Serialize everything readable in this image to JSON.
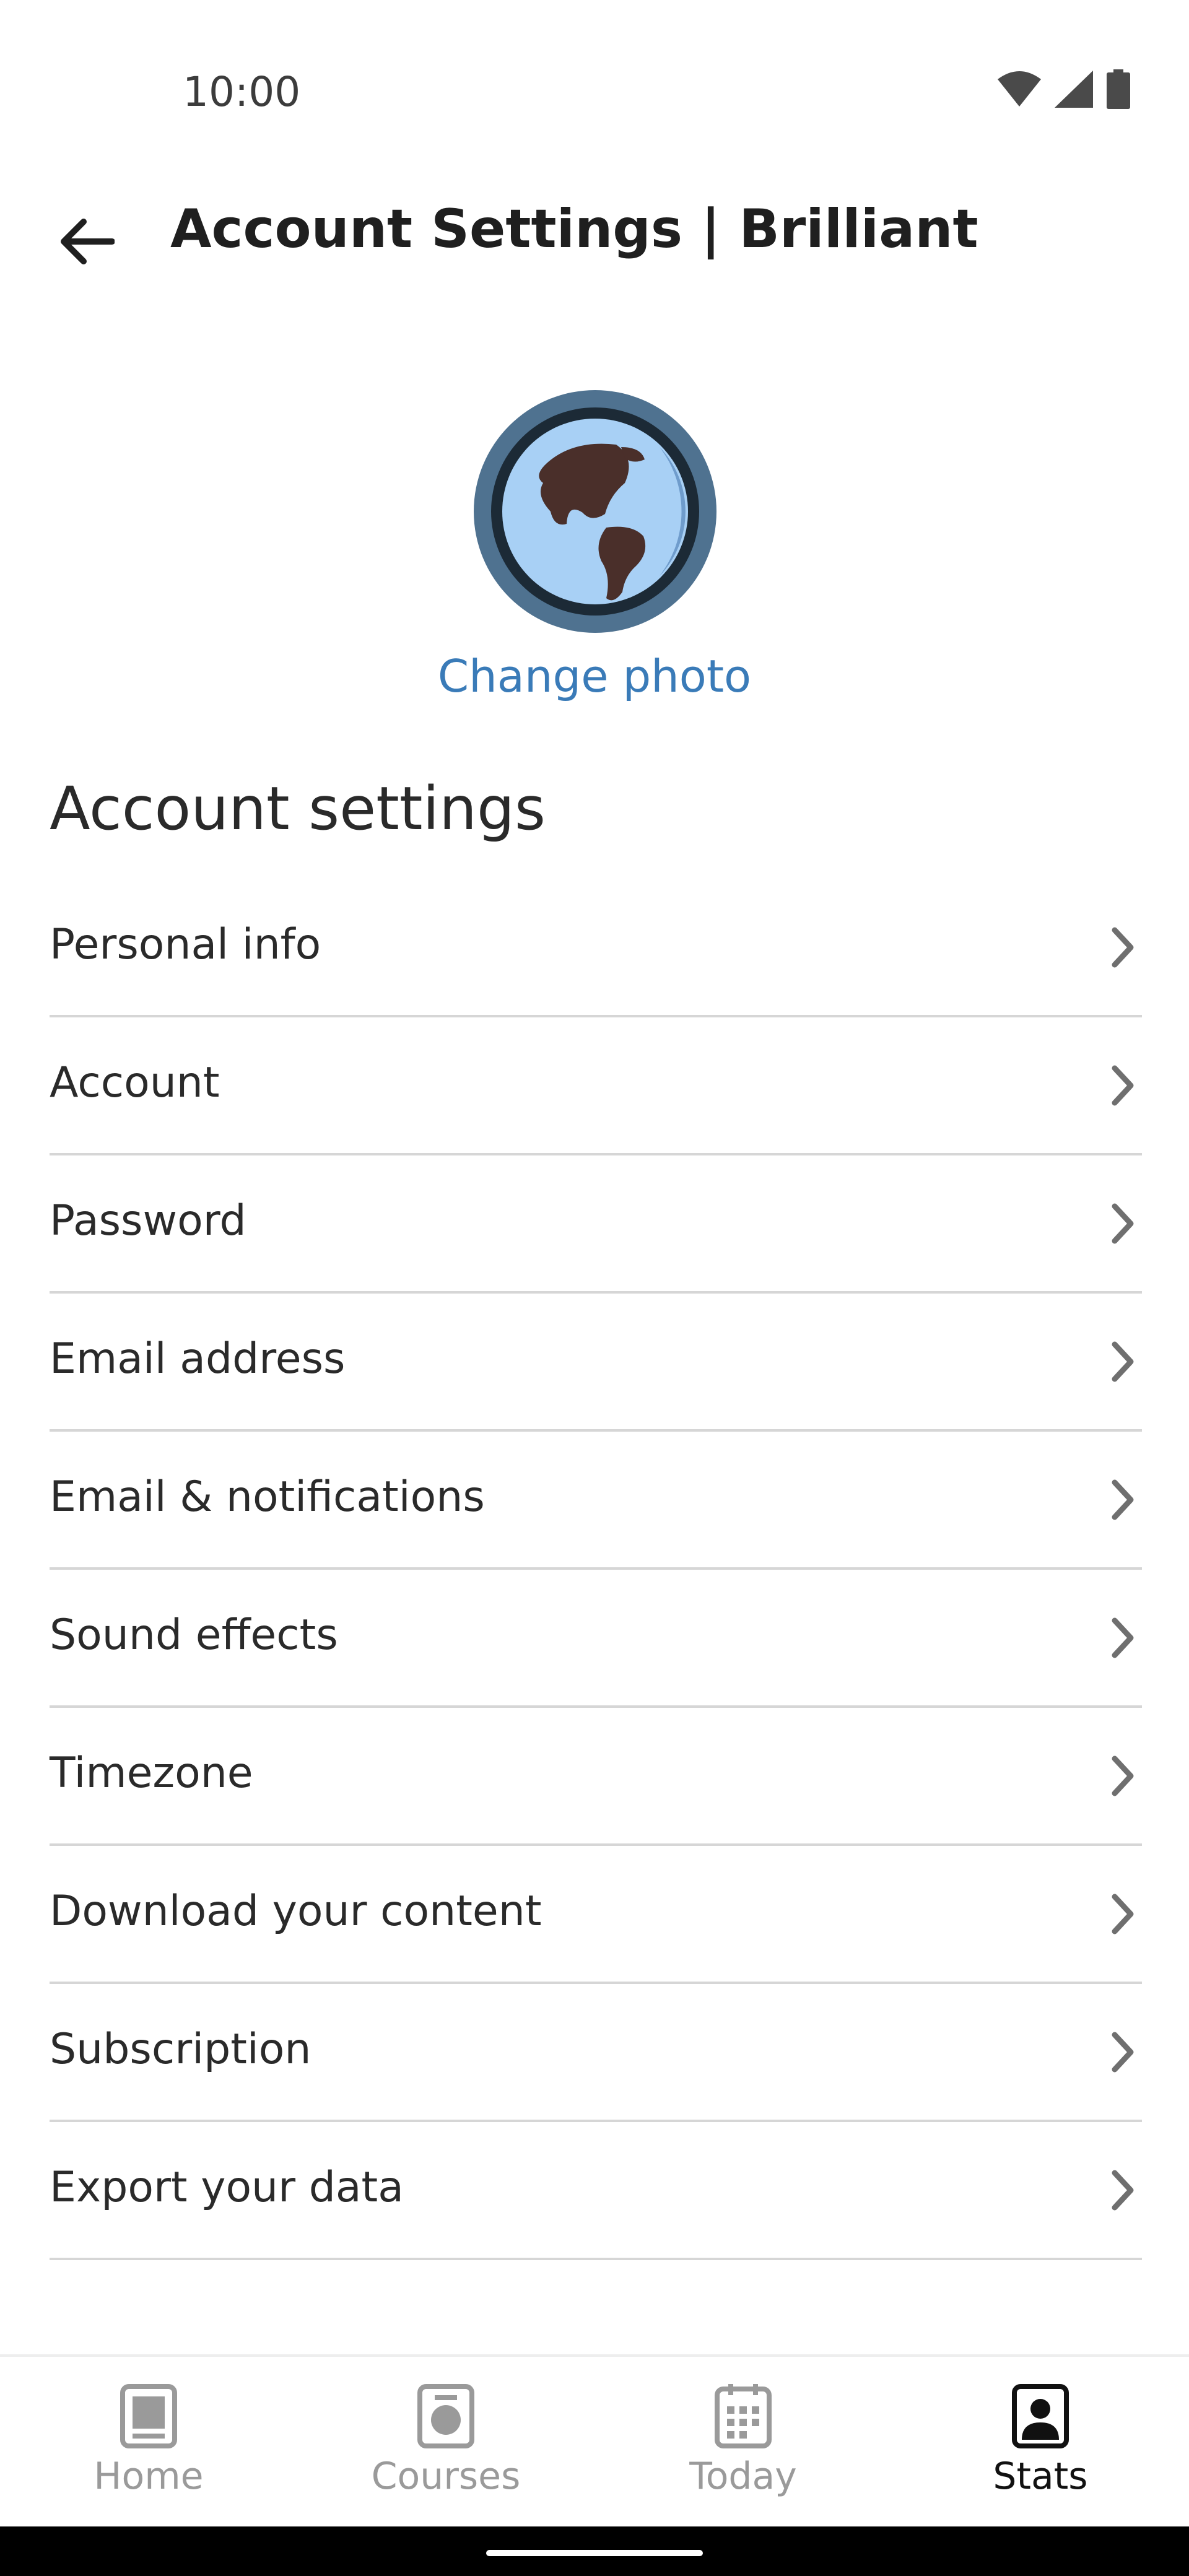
{
  "status_bar": {
    "time": "10:00",
    "icons": [
      "wifi-icon",
      "cell-signal-icon",
      "battery-icon"
    ]
  },
  "header": {
    "title": "Account Settings | Brilliant",
    "back_icon": "arrow-left-icon"
  },
  "profile": {
    "avatar_icon": "globe-icon",
    "change_photo_label": "Change photo"
  },
  "settings": {
    "heading": "Account settings",
    "items": [
      {
        "label": "Personal info"
      },
      {
        "label": "Account"
      },
      {
        "label": "Password"
      },
      {
        "label": "Email address"
      },
      {
        "label": "Email & notifications"
      },
      {
        "label": "Sound effects"
      },
      {
        "label": "Timezone"
      },
      {
        "label": "Download your content"
      },
      {
        "label": "Subscription"
      },
      {
        "label": "Export your data"
      }
    ]
  },
  "bottom_nav": {
    "items": [
      {
        "label": "Home",
        "icon": "home-icon",
        "active": false
      },
      {
        "label": "Courses",
        "icon": "courses-icon",
        "active": false
      },
      {
        "label": "Today",
        "icon": "calendar-icon",
        "active": false
      },
      {
        "label": "Stats",
        "icon": "stats-icon",
        "active": true
      }
    ]
  },
  "colors": {
    "accent": "#3a7bb8",
    "avatar_ring": "#4f7290",
    "globe_ocean": "#a8d0f5",
    "globe_land": "#4a2f2a",
    "inactive_nav": "#9a9a9a",
    "divider": "#d6d6d6"
  }
}
